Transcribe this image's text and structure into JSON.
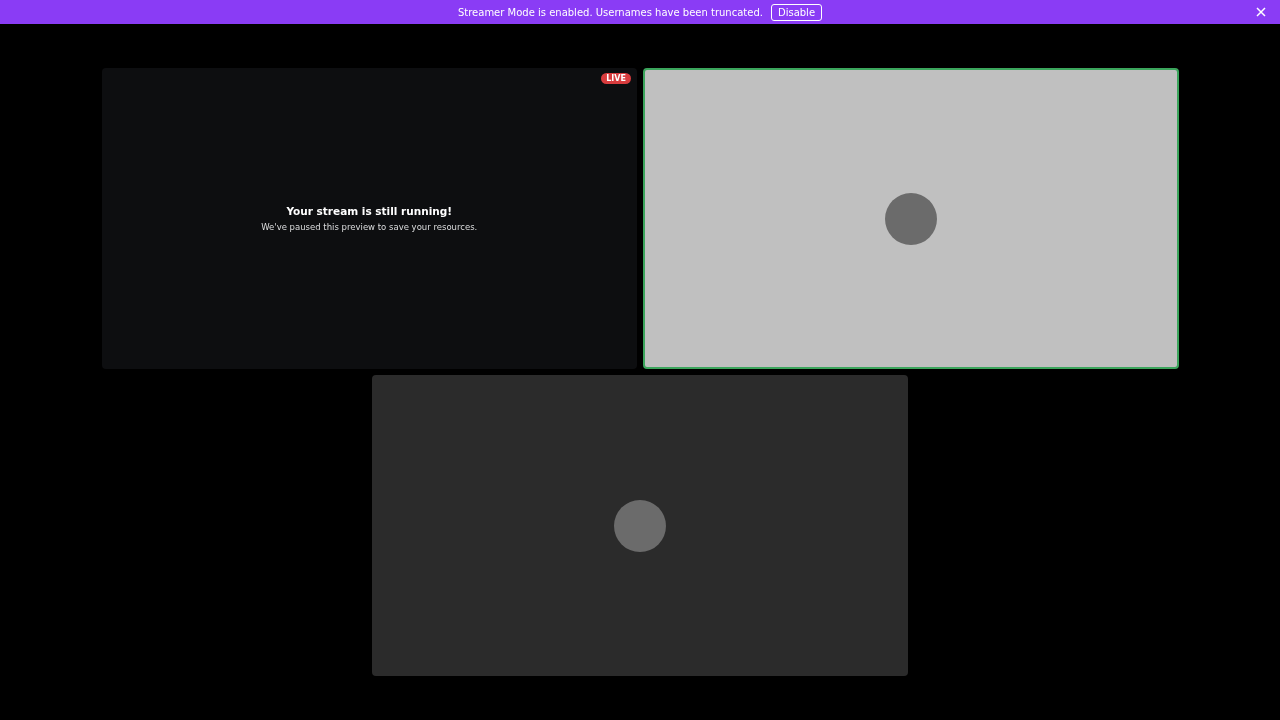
{
  "notice_bar": {
    "message": "Streamer Mode is enabled. Usernames have been truncated.",
    "button": "Disable"
  },
  "tiles": [
    {
      "kind": "stream",
      "badge": "LIVE",
      "title": "Your stream is still running!",
      "subtitle": "We've paused this preview to save your resources."
    },
    {
      "kind": "user",
      "speaking": true,
      "color": "#c0c0c0"
    },
    {
      "kind": "user",
      "speaking": false,
      "color": "#2b2b2b"
    }
  ]
}
